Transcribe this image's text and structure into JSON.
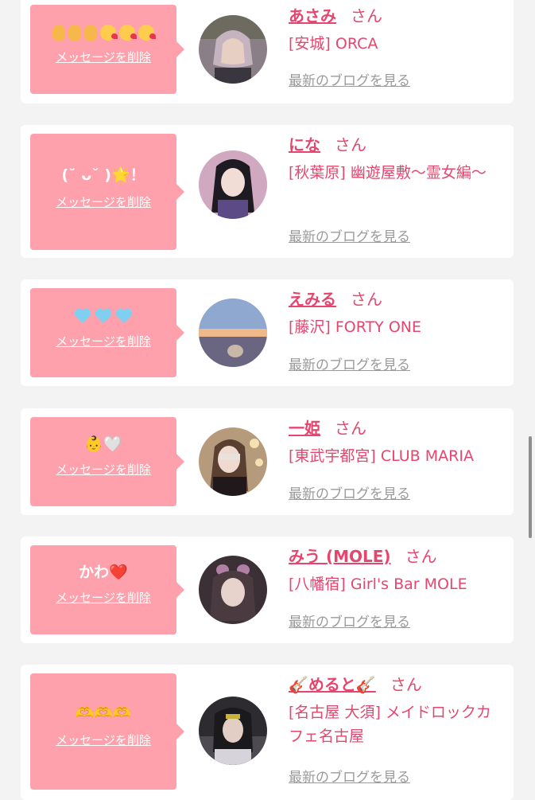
{
  "common": {
    "delete_label": "メッセージを削除",
    "honorific": "さん",
    "blog_label": "最新のブログを見る"
  },
  "colors": {
    "accent": "#e6466e",
    "bubble": "#ffa1ac",
    "card": "#ffffff",
    "background": "#f3f3f3",
    "muted": "#9a9a9a"
  },
  "items": [
    {
      "message": "",
      "message_icons": [
        "raised-hand-icon",
        "raised-hand-icon",
        "raised-hand-icon",
        "face-blowing-kiss-icon",
        "face-blowing-kiss-icon",
        "face-blowing-kiss-icon"
      ],
      "name": "あさみ",
      "shop": "[安城] ORCA"
    },
    {
      "message": "(˘ ᴗ˘ )🌟！",
      "message_icons": [],
      "name": "にな",
      "shop": "[秋葉原] 幽遊屋敷〜霊女編〜"
    },
    {
      "message": "",
      "message_icons": [
        "light-blue-heart-icon",
        "light-blue-heart-icon",
        "light-blue-heart-icon"
      ],
      "name": "えみる",
      "shop": "[藤沢] FORTY ONE"
    },
    {
      "message": "👶🤍",
      "message_icons": [
        "baby-icon",
        "white-heart-icon"
      ],
      "name": "一姫",
      "shop": "[東武宇都宮] CLUB MARIA"
    },
    {
      "message": "かわ❤️",
      "message_icons": [],
      "name": "みう (MOLE)",
      "shop": "[八幡宿] Girl's Bar MOLE"
    },
    {
      "message": "🫶🫶🫶",
      "message_icons": [
        "heart-hands-icon",
        "heart-hands-icon",
        "heart-hands-icon"
      ],
      "name": "🎸めると🎸",
      "shop": "[名古屋 大須] メイドロックカフェ名古屋"
    }
  ]
}
